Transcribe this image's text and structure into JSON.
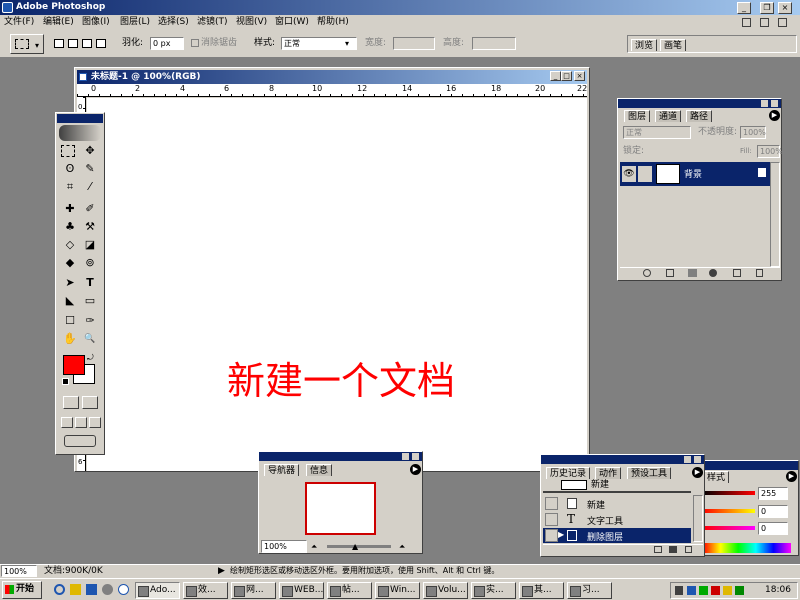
{
  "app": {
    "title": "Adobe Photoshop"
  },
  "window_controls": {
    "minimize": "_",
    "restore": "❐",
    "close": "×"
  },
  "menu": [
    "文件(F)",
    "编辑(E)",
    "图像(I)",
    "图层(L)",
    "选择(S)",
    "滤镜(T)",
    "视图(V)",
    "窗口(W)",
    "帮助(H)"
  ],
  "options": {
    "feather_label": "羽化:",
    "feather_value": "0 px",
    "antialias_label": "消除锯齿",
    "style_label": "样式:",
    "style_value": "正常",
    "width_label": "宽度:",
    "height_label": "高度:",
    "tabs": [
      "浏览",
      "画笔"
    ]
  },
  "document": {
    "title": "未标题-1 @ 100%(RGB)",
    "ruler_h": [
      "0",
      "2",
      "4",
      "6",
      "8",
      "10",
      "12",
      "14",
      "16",
      "18",
      "20",
      "22"
    ],
    "ruler_v": [
      "0",
      "2",
      "4",
      "6"
    ],
    "canvas_text": "新建一个文档"
  },
  "toolbox": {
    "tools": [
      "▭",
      "✥",
      "ʘ",
      "✎",
      "⌗",
      "⁄",
      "✚",
      "✐",
      "♣",
      "⚒",
      "◇",
      "◪",
      "◆",
      "⊚",
      "➤",
      "T",
      "◣",
      "▭",
      "☐",
      "✑",
      "✋",
      "🔍"
    ],
    "fg_color": "#ff0000",
    "bg_color": "#ffffff"
  },
  "layers": {
    "tabs": [
      "图层",
      "通道",
      "路径"
    ],
    "blend_mode": "正常",
    "opacity_label": "不透明度:",
    "opacity_value": "100%",
    "lock_label": "锁定:",
    "fill_label": "Fill:",
    "fill_value": "100%",
    "layer_name": "背景"
  },
  "navigator": {
    "tabs": [
      "导航器",
      "信息"
    ],
    "zoom": "100%"
  },
  "history": {
    "tabs": [
      "历史记录",
      "动作",
      "预设工具"
    ],
    "snapshot": "新建",
    "items": [
      "新建",
      "文字工具",
      "删除图层"
    ]
  },
  "styles": {
    "tab": "样式",
    "values": [
      "255",
      "0",
      "0"
    ]
  },
  "status": {
    "zoom": "100%",
    "doc_info": "文档:900K/0K",
    "hint": "绘制矩形选区或移动选区外框。要用附加选项，使用 Shift、Alt 和 Ctrl 键。"
  },
  "taskbar": {
    "start": "开始",
    "tasks": [
      "Ado...",
      "效...",
      "网...",
      "WEB...",
      "帖...",
      "Win...",
      "Volu...",
      "实...",
      "其...",
      "习..."
    ],
    "clock": "18:06"
  }
}
